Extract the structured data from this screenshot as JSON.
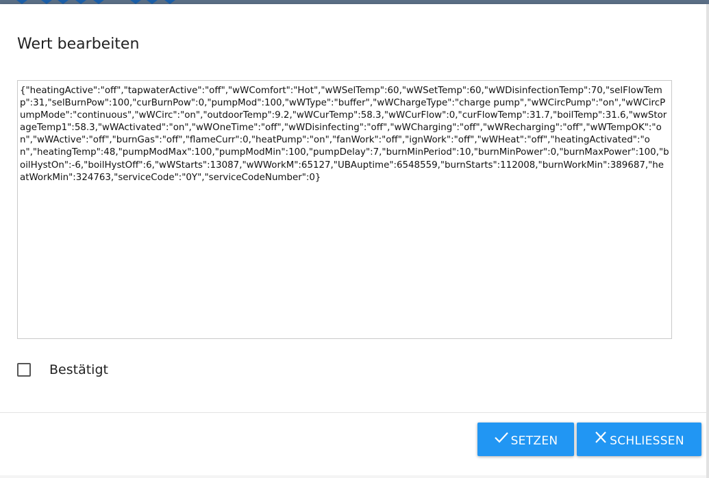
{
  "dialog": {
    "title": "Wert bearbeiten",
    "value": "{\"heatingActive\":\"off\",\"tapwaterActive\":\"off\",\"wWComfort\":\"Hot\",\"wWSelTemp\":60,\"wWSetTemp\":60,\"wWDisinfectionTemp\":70,\"selFlowTemp\":31,\"selBurnPow\":100,\"curBurnPow\":0,\"pumpMod\":100,\"wWType\":\"buffer\",\"wWChargeType\":\"charge pump\",\"wWCircPump\":\"on\",\"wWCircPumpMode\":\"continuous\",\"wWCirc\":\"on\",\"outdoorTemp\":9.2,\"wWCurTemp\":58.3,\"wWCurFlow\":0,\"curFlowTemp\":31.7,\"boilTemp\":31.6,\"wwStorageTemp1\":58.3,\"wWActivated\":\"on\",\"wWOneTime\":\"off\",\"wWDisinfecting\":\"off\",\"wWCharging\":\"off\",\"wWRecharging\":\"off\",\"wWTempOK\":\"on\",\"wWActive\":\"off\",\"burnGas\":\"off\",\"flameCurr\":0,\"heatPump\":\"on\",\"fanWork\":\"off\",\"ignWork\":\"off\",\"wWHeat\":\"off\",\"heatingActivated\":\"on\",\"heatingTemp\":48,\"pumpModMax\":100,\"pumpModMin\":100,\"pumpDelay\":7,\"burnMinPeriod\":10,\"burnMinPower\":0,\"burnMaxPower\":100,\"boilHystOn\":-6,\"boilHystOff\":6,\"wWStarts\":13087,\"wWWorkM\":65127,\"UBAuptime\":6548559,\"burnStarts\":112008,\"burnWorkMin\":389687,\"heatWorkMin\":324763,\"serviceCode\":\"0Y\",\"serviceCodeNumber\":0}",
    "confirm_label": "Bestätigt",
    "confirm_checked": false,
    "buttons": {
      "set_label": "SETZEN",
      "set_icon": "check-icon",
      "close_label": "SCHLIESSEN",
      "close_icon": "close-icon"
    }
  },
  "colors": {
    "accent": "#2196f3",
    "overlay": "#9a9a9a"
  }
}
